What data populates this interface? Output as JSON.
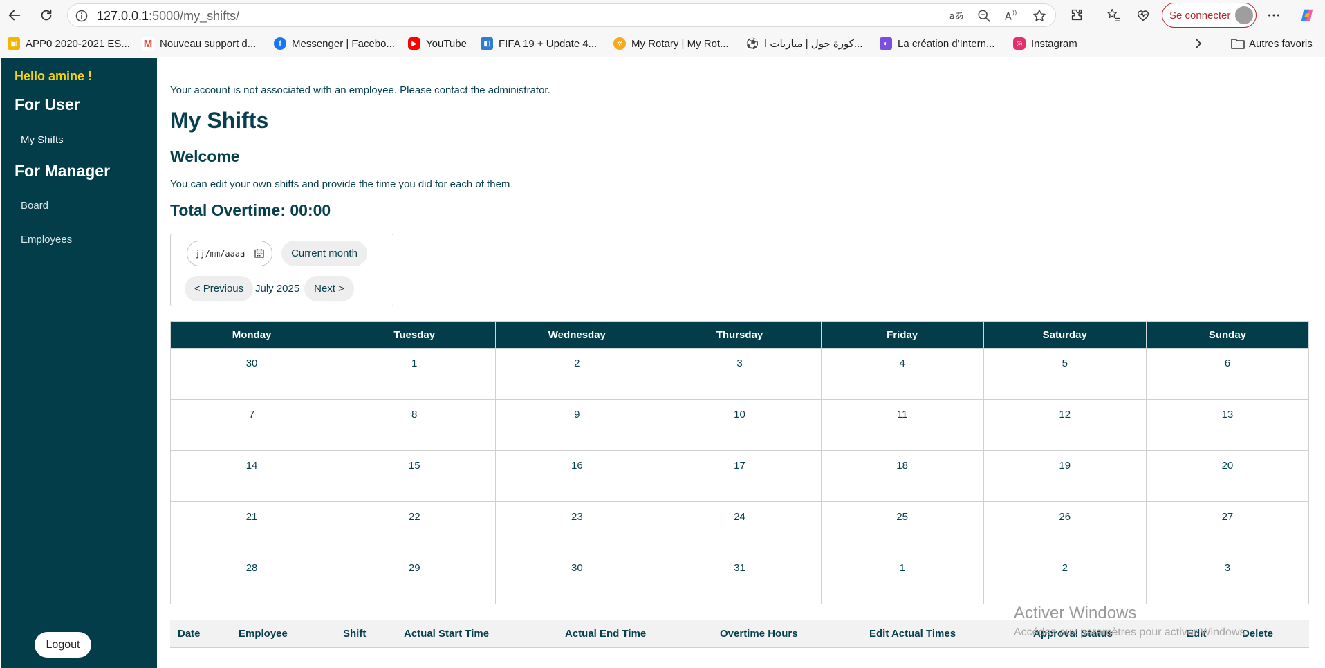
{
  "browser": {
    "url_host": "127.0.0.1",
    "url_path": ":5000/my_shifts/",
    "signin_label": "Se connecter",
    "bookmarks": [
      {
        "label": "APP0 2020-2021 ES...",
        "icon": "classroom-icon",
        "color": "#f4b400"
      },
      {
        "label": "Nouveau support d...",
        "icon": "gmail-icon",
        "color": "#ea4335"
      },
      {
        "label": "Messenger | Facebo...",
        "icon": "facebook-icon",
        "color": "#1877f2"
      },
      {
        "label": "YouTube",
        "icon": "youtube-icon",
        "color": "#ff0000"
      },
      {
        "label": "FIFA 19 + Update 4...",
        "icon": "site-icon",
        "color": "#2f7cd3"
      },
      {
        "label": "My Rotary | My Rot...",
        "icon": "rotary-icon",
        "color": "#f7a81b"
      },
      {
        "label": "كورة جول | مباريات ا...",
        "icon": "football-icon",
        "color": "#444444"
      },
      {
        "label": "La création d'Intern...",
        "icon": "site-icon",
        "color": "#7b4ee0"
      },
      {
        "label": "Instagram",
        "icon": "instagram-icon",
        "color": "#e1306c"
      }
    ],
    "other_favorites": "Autres favoris"
  },
  "sidebar": {
    "greeting": "Hello amine !",
    "section_user": "For User",
    "link_my_shifts": "My Shifts",
    "section_manager": "For Manager",
    "link_board": "Board",
    "link_employees": "Employees",
    "logout": "Logout"
  },
  "main": {
    "notice": "Your account is not associated with an employee. Please contact the administrator.",
    "title": "My Shifts",
    "welcome": "Welcome",
    "description": "You can edit your own shifts and provide the time you did for each of them",
    "total_overtime": "Total Overtime: 00:00",
    "date_placeholder": "jj/mm/aaaa",
    "current_month_button": "Current month",
    "previous_button": "< Previous",
    "month_label": "July 2025",
    "next_button": "Next >"
  },
  "calendar": {
    "days": [
      "Monday",
      "Tuesday",
      "Wednesday",
      "Thursday",
      "Friday",
      "Saturday",
      "Sunday"
    ],
    "weeks": [
      [
        "30",
        "1",
        "2",
        "3",
        "4",
        "5",
        "6"
      ],
      [
        "7",
        "8",
        "9",
        "10",
        "11",
        "12",
        "13"
      ],
      [
        "14",
        "15",
        "16",
        "17",
        "18",
        "19",
        "20"
      ],
      [
        "21",
        "22",
        "23",
        "24",
        "25",
        "26",
        "27"
      ],
      [
        "28",
        "29",
        "30",
        "31",
        "1",
        "2",
        "3"
      ]
    ]
  },
  "shifts_table": {
    "columns": [
      "Date",
      "Employee",
      "Shift",
      "Actual Start Time",
      "Actual End Time",
      "Overtime Hours",
      "Edit Actual Times",
      "Approval Status",
      "Edit",
      "Delete"
    ]
  },
  "watermark": {
    "line1": "Activer Windows",
    "line2": "Accédez aux paramètres pour activer Windows."
  },
  "colors": {
    "sidebar": "#023d49",
    "accent_text": "#063f4d",
    "greeting": "#f8d30a"
  }
}
